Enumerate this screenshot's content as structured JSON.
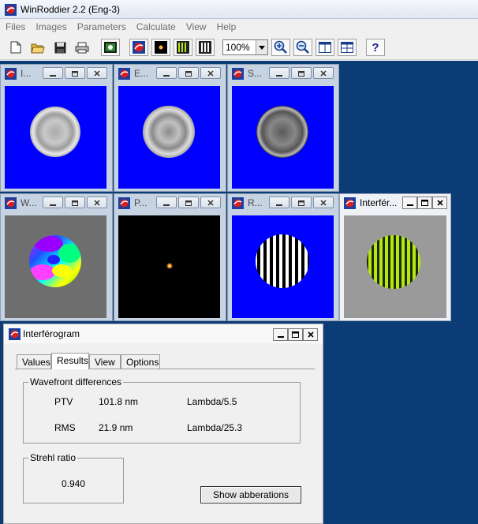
{
  "app": {
    "title": "WinRoddier 2.2 (Eng-3)"
  },
  "menu": [
    "Files",
    "Images",
    "Parameters",
    "Calculate",
    "View",
    "Help"
  ],
  "toolbar": {
    "zoom": "100%"
  },
  "windows": [
    {
      "title": "I...",
      "image": "intra-focal"
    },
    {
      "title": "E...",
      "image": "extra-focal"
    },
    {
      "title": "S...",
      "image": "sum"
    },
    {
      "title": "W...",
      "image": "wavefront-map"
    },
    {
      "title": "P...",
      "image": "psf"
    },
    {
      "title": "R...",
      "image": "ronchigram"
    },
    {
      "title": "Interfér...",
      "image": "interferogram"
    }
  ],
  "results": {
    "title": "Interférogram",
    "tabs": [
      "Values",
      "Results",
      "View",
      "Options"
    ],
    "selected_tab": "Results",
    "wavefront": {
      "label": "Wavefront differences",
      "ptv_label": "PTV",
      "ptv_value": "101.8 nm",
      "ptv_lambda": "Lambda/5.5",
      "rms_label": "RMS",
      "rms_value": "21.9 nm",
      "rms_lambda": "Lambda/25.3"
    },
    "strehl": {
      "label": "Strehl ratio",
      "value": "0.940"
    },
    "button": "Show abberations"
  },
  "colors": {
    "mdi_background": "#0b3c75",
    "image_blue": "#0000ff",
    "interferogram_fringe": "#b6e614"
  }
}
